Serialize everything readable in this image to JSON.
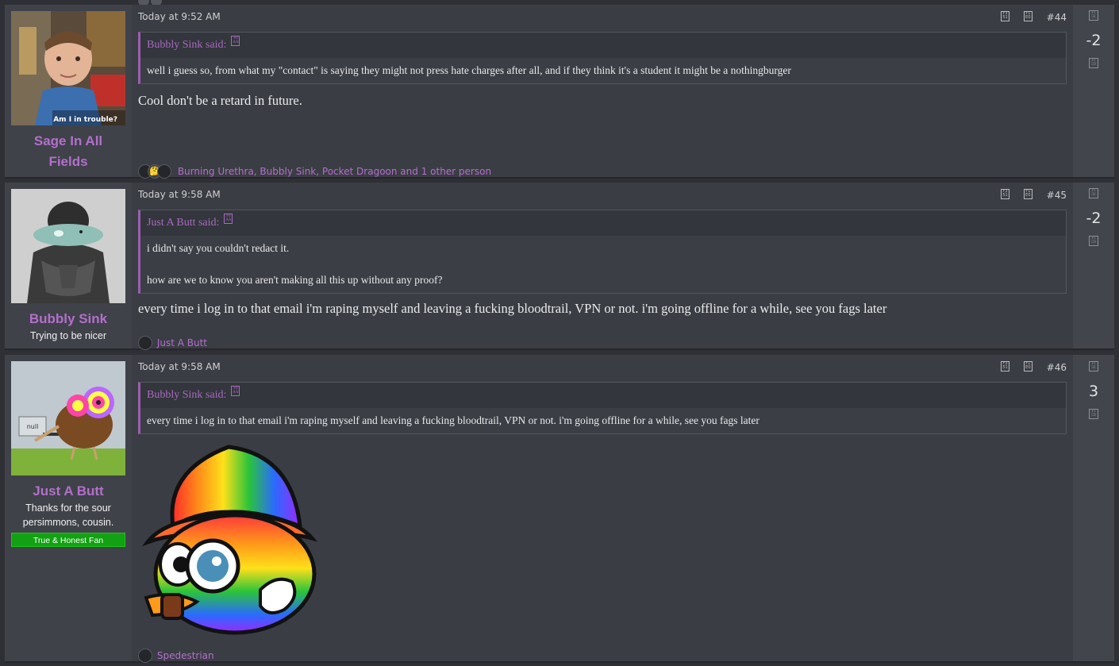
{
  "posts": [
    {
      "username": "Sage In All Fields",
      "avatar_caption": "Am I in trouble?",
      "date": "Today at 9:52 AM",
      "number": "#44",
      "quote": {
        "author": "Bubbly Sink said:",
        "lines": [
          "well i guess so, from what my \"contact\" is saying they might not press hate charges after all, and if they think it's a student it might be a nothingburger"
        ]
      },
      "text": "Cool don't be a retard in future.",
      "reactions": "Burning Urethra, Bubbly Sink, Pocket Dragoon and 1 other person",
      "score": "-2"
    },
    {
      "username": "Bubbly Sink",
      "user_title": "Trying to be nicer",
      "date": "Today at 9:58 AM",
      "number": "#45",
      "quote": {
        "author": "Just A Butt said:",
        "lines": [
          "i didn't say you couldn't redact it.",
          "how are we to know you aren't making all this up without any proof?"
        ]
      },
      "text": "every time i log in to that email i'm raping myself and leaving a fucking bloodtrail, VPN or not. i'm going offline for a while, see you fags later",
      "reactions": "Just A Butt",
      "score": "-2"
    },
    {
      "username": "Just A Butt",
      "user_title": "Thanks for the sour persimmons, cousin.",
      "banner": "True & Honest Fan",
      "date": "Today at 9:58 AM",
      "number": "#46",
      "quote": {
        "author": "Bubbly Sink said:",
        "lines": [
          "every time i log in to that email i'm raping myself and leaving a fucking bloodtrail, VPN or not. i'm going offline for a while, see you fags later"
        ]
      },
      "reactions": "Spedestrian",
      "score": "3"
    }
  ],
  "icons": {
    "quote_jump": "arrow-up-box-icon",
    "share": "share-icon",
    "bookmark": "bookmark-icon",
    "upvote": "upvote-icon",
    "downvote": "downvote-icon"
  },
  "colors": {
    "username": "#b36fcb",
    "banner": "#12a112",
    "background": "#2e3035",
    "post": "#3a3d44"
  }
}
